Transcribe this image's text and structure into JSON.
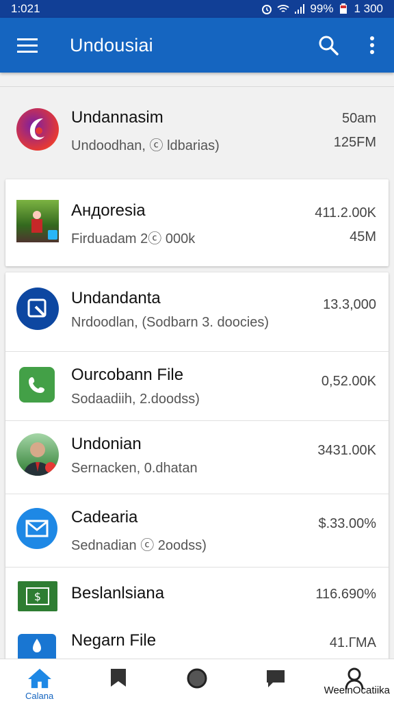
{
  "status_bar": {
    "time": "1:021",
    "battery": "99%",
    "clock_right": "1 300"
  },
  "app_bar": {
    "title": "Undousiai"
  },
  "rows": [
    {
      "name": "Undannasim",
      "sub": "Undoodhan, ⓒ ldbarias)",
      "meta1": "50am",
      "meta2": "125FM"
    },
    {
      "name": "Андоresia",
      "sub": "Firduadam 2ⓒ 000k",
      "meta1": "411.2.00K",
      "meta2": "45M"
    },
    {
      "name": "Undandanta",
      "sub": "Nrdoodlan, (Sodbarn 3. doocies)",
      "meta1": "13.3,000",
      "meta2": ""
    },
    {
      "name": "Ourcobann File",
      "sub": "Sodaadiih, 2.doodss)",
      "meta1": "0,52.00K",
      "meta2": ""
    },
    {
      "name": "Undonian",
      "sub": "Sernacken, 0.dhatan",
      "meta1": "3431.00K",
      "meta2": ""
    },
    {
      "name": "Cadearia",
      "sub": "Sednadian ⓒ 2oodss)",
      "meta1": "$.33.00%",
      "meta2": ""
    },
    {
      "name": "Beslanlsiana",
      "sub": "",
      "meta1": "116.690%",
      "meta2": ""
    },
    {
      "name": "Negarn File",
      "sub": "",
      "meta1": "41.ГМА",
      "meta2": ""
    }
  ],
  "bottom_nav": {
    "home_label": "Calana",
    "watermark": "WeeinOcatiika"
  },
  "colors": {
    "appbar": "#1565c0",
    "statusbar": "#113f96",
    "accent": "#1565c0"
  }
}
